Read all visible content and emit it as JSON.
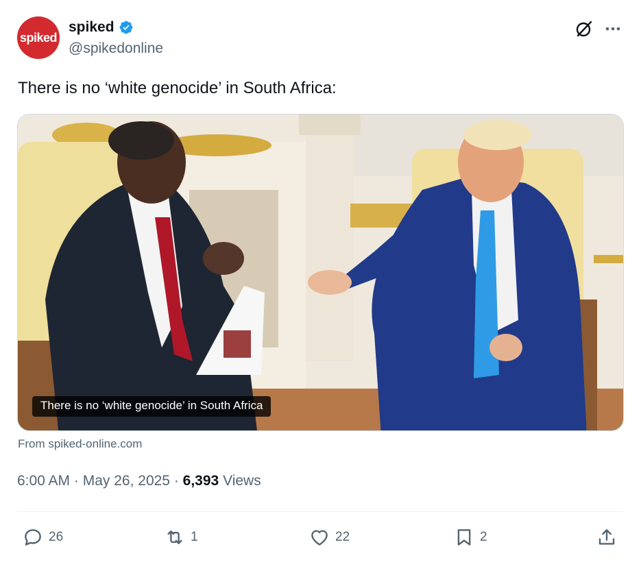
{
  "author": {
    "avatar_text": "spiked",
    "display_name": "spiked",
    "handle": "@spikedonline",
    "verified": true,
    "brand_color": "#d22a2f",
    "verified_color": "#1d9bf0"
  },
  "tweet": {
    "text": "There is no ‘white genocide’ in South Africa:"
  },
  "media": {
    "caption": "There is no ‘white genocide’ in South Africa",
    "source": "From spiked-online.com"
  },
  "meta": {
    "time": "6:00 AM",
    "separator": " · ",
    "date": "May 26, 2025",
    "views_count": "6,393",
    "views_label": " Views"
  },
  "actions": {
    "replies": "26",
    "reposts": "1",
    "likes": "22",
    "bookmarks": "2"
  },
  "icons": {
    "header": [
      "grok-icon",
      "more-icon"
    ],
    "actions": [
      "reply-icon",
      "repost-icon",
      "like-icon",
      "bookmark-icon",
      "share-icon"
    ]
  }
}
